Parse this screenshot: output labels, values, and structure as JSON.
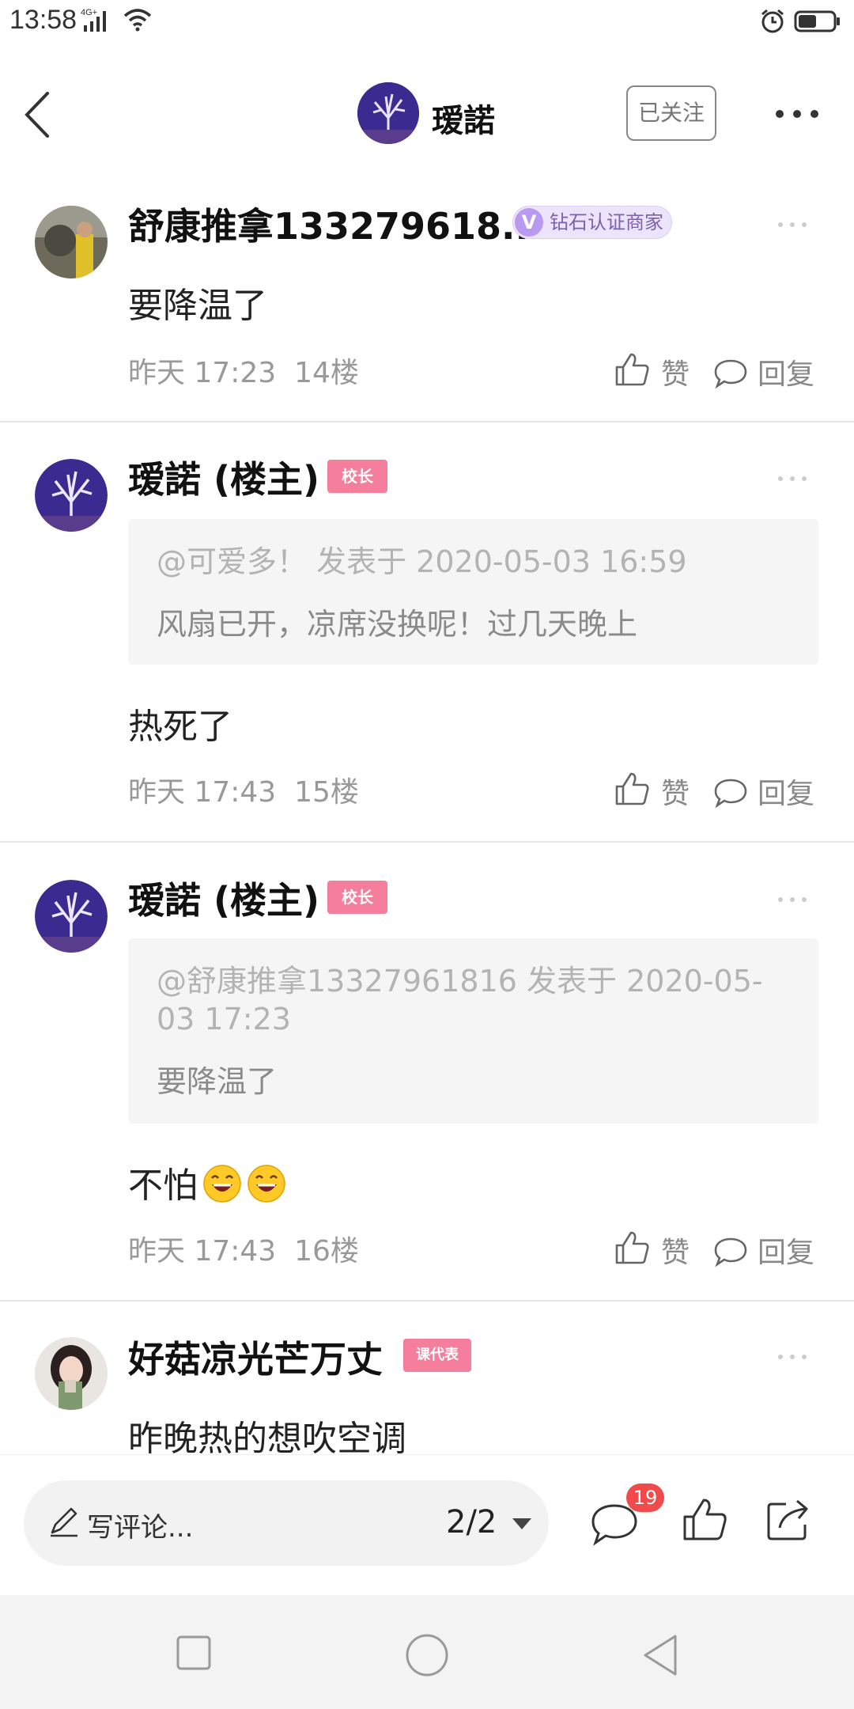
{
  "status_bar": {
    "time": "13:58",
    "network": "4G+"
  },
  "header": {
    "name": "瑷諾",
    "follow_label": "已关注"
  },
  "posts": [
    {
      "username": "舒康推拿133279618...",
      "badge": "钻石认证商家",
      "badge_mark": "V",
      "content": "要降温了",
      "time": "昨天 17:23",
      "floor": "14楼",
      "like_label": "赞",
      "reply_label": "回复"
    },
    {
      "username": "瑷諾 (楼主)",
      "badge": "校长",
      "quote_head": "@可爱多！  发表于 2020-05-03 16:59",
      "quote_text": "风扇已开，凉席没换呢！过几天晚上",
      "content": "热死了",
      "time": "昨天 17:43",
      "floor": "15楼",
      "like_label": "赞",
      "reply_label": "回复"
    },
    {
      "username": "瑷諾 (楼主)",
      "badge": "校长",
      "quote_head": "@舒康推拿13327961816 发表于 2020-05-03 17:23",
      "quote_text": "要降温了",
      "content": "不怕",
      "time": "昨天 17:43",
      "floor": "16楼",
      "like_label": "赞",
      "reply_label": "回复"
    },
    {
      "username": "好菇凉光芒万丈",
      "badge": "课代表",
      "content": "昨晚热的想吹空调"
    }
  ],
  "bottom_bar": {
    "comment_placeholder": "写评论...",
    "page_indicator": "2/2",
    "comment_count": "19"
  },
  "colors": {
    "accent_pink": "#f47e9c",
    "vip_purple": "#7d5fb2",
    "badge_red": "#f04a4a"
  }
}
